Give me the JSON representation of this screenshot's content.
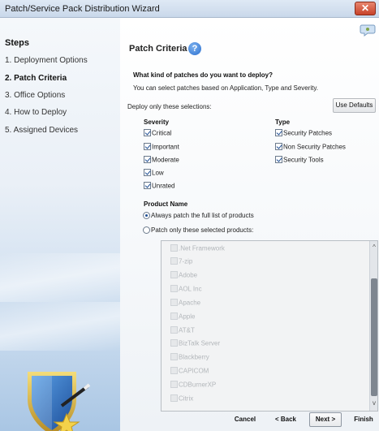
{
  "window": {
    "title": "Patch/Service Pack Distribution Wizard",
    "close_label": "✕"
  },
  "sidebar": {
    "steps_title": "Steps",
    "steps": [
      {
        "label": "1. Deployment Options"
      },
      {
        "label": "2. Patch Criteria"
      },
      {
        "label": "3. Office Options"
      },
      {
        "label": "4. How to Deploy"
      },
      {
        "label": "5. Assigned Devices"
      }
    ],
    "active_step": 1,
    "logo_icon": "shield-wand-icon"
  },
  "main": {
    "title": "Patch Criteria",
    "help_icon": "help-icon",
    "corner_icon": "chat-bubble-icon",
    "question": "What kind of patches do you want to deploy?",
    "description": "You can select patches based on Application, Type and Severity.",
    "deploy_label": "Deploy only these selections:",
    "use_defaults_label": "Use Defaults",
    "severity": {
      "heading": "Severity",
      "items": [
        {
          "label": "Critical",
          "checked": true
        },
        {
          "label": "Important",
          "checked": true
        },
        {
          "label": "Moderate",
          "checked": true
        },
        {
          "label": "Low",
          "checked": true
        },
        {
          "label": "Unrated",
          "checked": true
        }
      ]
    },
    "type": {
      "heading": "Type",
      "items": [
        {
          "label": "Security Patches",
          "checked": true
        },
        {
          "label": "Non Security Patches",
          "checked": true
        },
        {
          "label": "Security Tools",
          "checked": true
        }
      ]
    },
    "product": {
      "heading": "Product Name",
      "radio_all": "Always patch the full list of products",
      "radio_selected": "Patch only these selected products:",
      "selected_option": "all",
      "products": [
        ".Net Framework",
        "7-zip",
        "Adobe",
        "AOL Inc",
        "Apache",
        "Apple",
        "AT&T",
        "BizTalk Server",
        "Blackberry",
        "CAPICOM",
        "CDBurnerXP",
        "Citrix"
      ]
    }
  },
  "footer": {
    "cancel": "Cancel",
    "back": "< Back",
    "next": "Next >",
    "finish": "Finish"
  },
  "colors": {
    "accent": "#1f4f94",
    "sidebar_bottom": "#a9c6e4",
    "close": "#c7432a"
  }
}
